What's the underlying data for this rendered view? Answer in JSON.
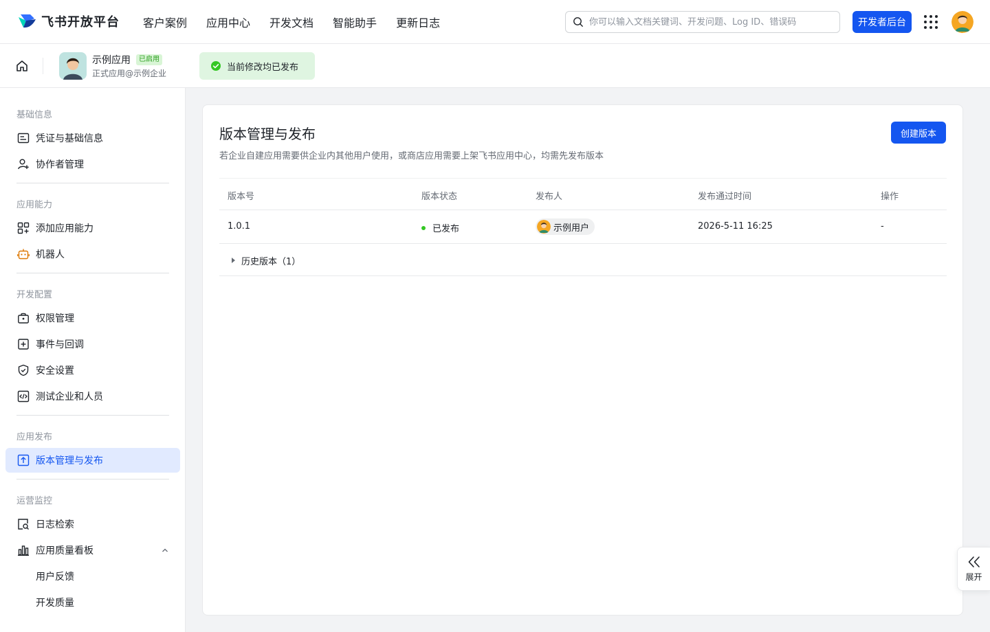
{
  "topbar": {
    "logo_text": "飞书开放平台",
    "nav": [
      "客户案例",
      "应用中心",
      "开发文档",
      "智能助手",
      "更新日志"
    ],
    "search_placeholder": "你可以输入文档关键词、开发问题、Log ID、错误码",
    "console_button": "开发者后台"
  },
  "app": {
    "name": "示例应用",
    "badge": "已启用",
    "subtitle": "正式应用@示例企业",
    "publish_status": "当前修改均已发布"
  },
  "sidebar": {
    "sections": [
      {
        "title": "基础信息",
        "items": [
          {
            "label": "凭证与基础信息",
            "icon": "id-card-icon"
          },
          {
            "label": "协作者管理",
            "icon": "user-add-icon"
          }
        ]
      },
      {
        "title": "应用能力",
        "items": [
          {
            "label": "添加应用能力",
            "icon": "apps-add-icon"
          },
          {
            "label": "机器人",
            "icon": "robot-icon"
          }
        ]
      },
      {
        "title": "开发配置",
        "items": [
          {
            "label": "权限管理",
            "icon": "lock-icon"
          },
          {
            "label": "事件与回调",
            "icon": "event-icon"
          },
          {
            "label": "安全设置",
            "icon": "shield-icon"
          },
          {
            "label": "测试企业和人员",
            "icon": "code-icon"
          }
        ]
      },
      {
        "title": "应用发布",
        "items": [
          {
            "label": "版本管理与发布",
            "icon": "upload-icon",
            "active": true
          }
        ]
      },
      {
        "title": "运营监控",
        "items": [
          {
            "label": "日志检索",
            "icon": "log-search-icon"
          },
          {
            "label": "应用质量看板",
            "icon": "bar-chart-icon",
            "expanded": true
          },
          {
            "label": "用户反馈"
          },
          {
            "label": "开发质量"
          }
        ]
      }
    ]
  },
  "main": {
    "title": "版本管理与发布",
    "description": "若企业自建应用需要供企业内其他用户使用，或商店应用需要上架飞书应用中心，均需先发布版本",
    "create_button": "创建版本",
    "columns": [
      "版本号",
      "版本状态",
      "发布人",
      "发布通过时间",
      "操作"
    ],
    "rows": [
      {
        "version": "1.0.1",
        "status": "已发布",
        "publisher": "示例用户",
        "time": "2026-5-11 16:25",
        "action": "-"
      }
    ],
    "history": "历史版本（1）"
  },
  "expand": {
    "label": "展开"
  },
  "colors": {
    "accent": "#1456f0",
    "success": "#34c724",
    "active_bg": "#e1eaff"
  }
}
